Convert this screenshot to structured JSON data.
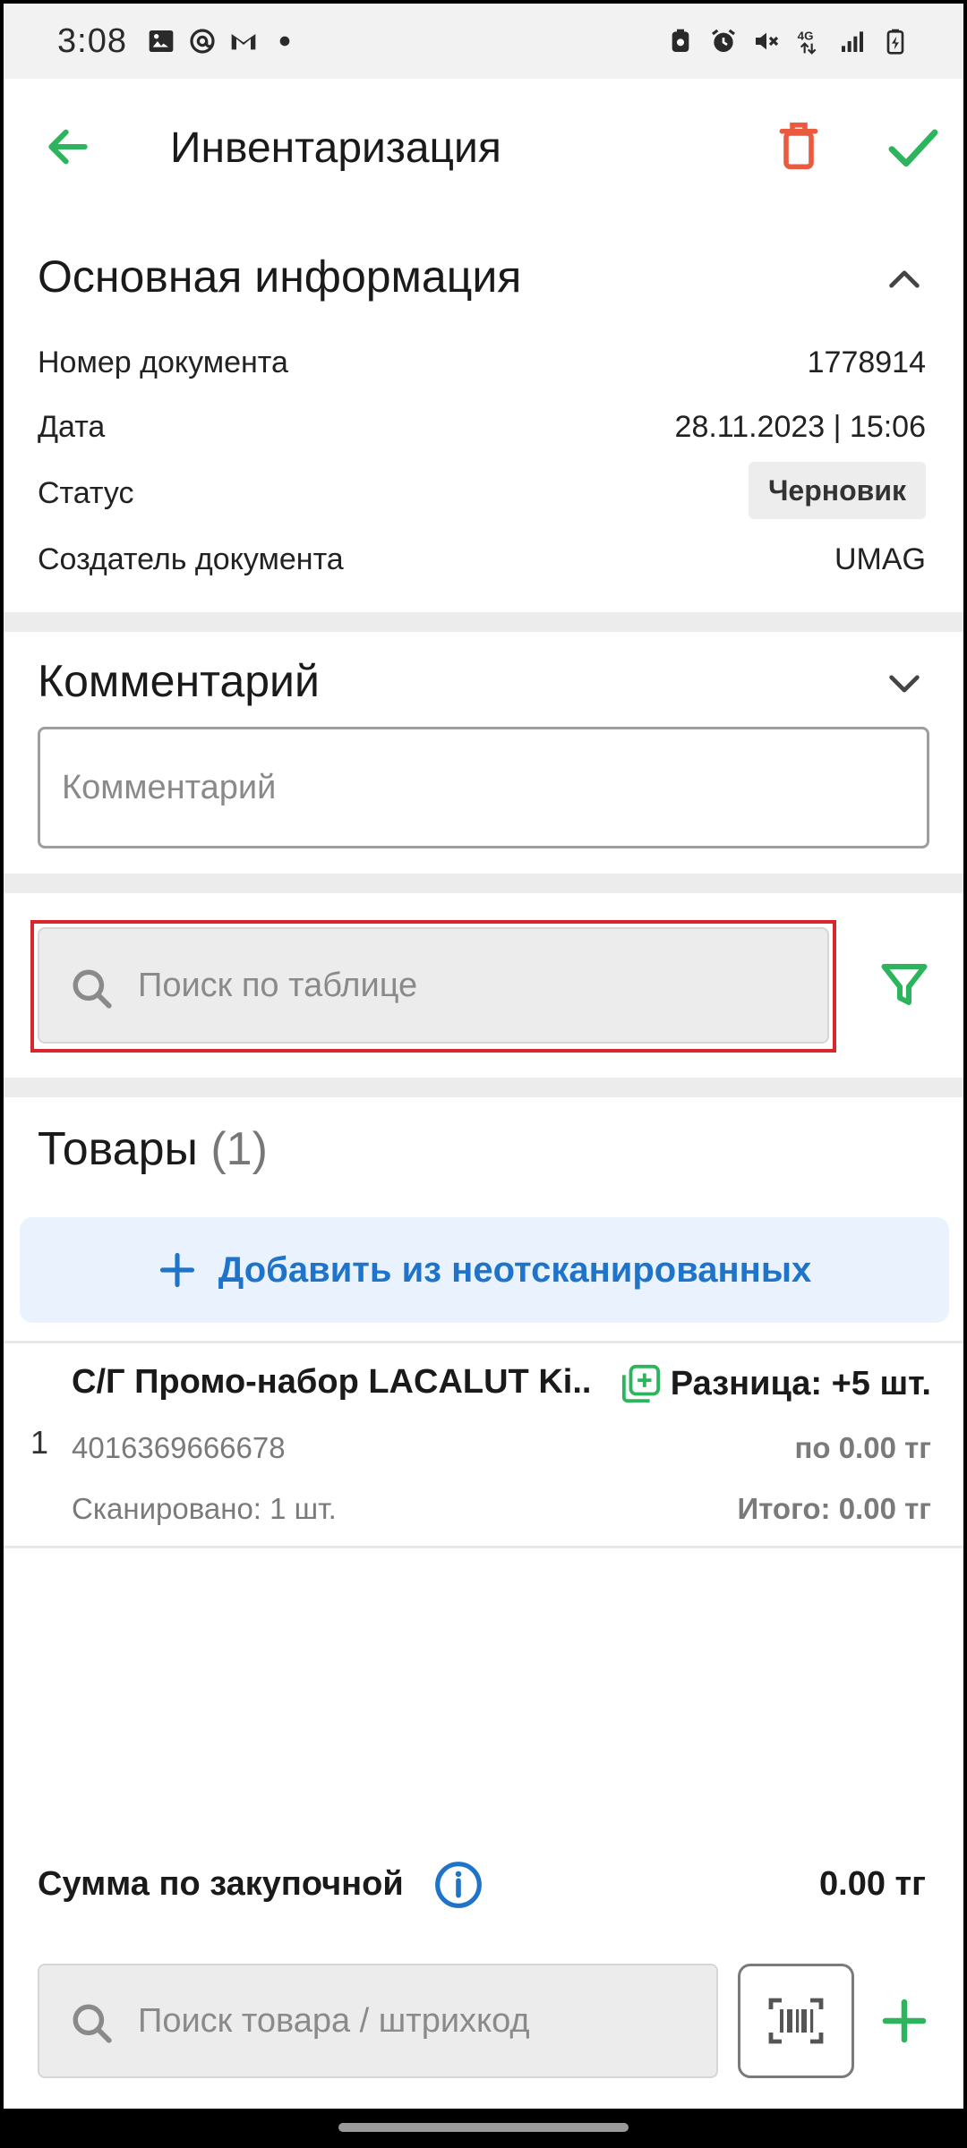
{
  "status_bar": {
    "time": "3:08",
    "left_icons": [
      "gallery-icon",
      "at-icon",
      "gmail-icon",
      "dot-icon"
    ],
    "right_icons": [
      "battery-saver-icon",
      "alarm-icon",
      "mute-icon",
      "network-4g-icon",
      "signal-icon",
      "battery-icon"
    ]
  },
  "app_bar": {
    "title": "Инвентаризация",
    "back_icon": "arrow-left-icon",
    "delete_icon": "trash-icon",
    "confirm_icon": "checkmark-icon"
  },
  "main_info": {
    "title": "Основная информация",
    "rows": [
      {
        "label": "Номер документа",
        "value": "1778914"
      },
      {
        "label": "Дата",
        "value": "28.11.2023 | 15:06"
      },
      {
        "label": "Статус",
        "value": "Черновик"
      },
      {
        "label": "Создатель документа",
        "value": "UMAG"
      }
    ]
  },
  "comment": {
    "title": "Комментарий",
    "placeholder": "Комментарий",
    "value": ""
  },
  "table_search": {
    "placeholder": "Поиск по таблице"
  },
  "goods": {
    "title": "Товары",
    "count": "(1)",
    "add_label": "Добавить из неотсканированных",
    "items": [
      {
        "index": "1",
        "name": "С/Г Промо-набор LACALUT Ki..",
        "barcode": "4016369666678",
        "scanned": "Сканировано: 1 шт.",
        "difference": "Разница: +5 шт.",
        "price": "по 0.00 тг",
        "total": "Итого: 0.00 тг"
      }
    ]
  },
  "summary": {
    "label": "Сумма по закупочной",
    "value": "0.00 тг"
  },
  "bottom_search": {
    "placeholder": "Поиск товара / штрихкод"
  },
  "colors": {
    "accent_green": "#2db55d",
    "delete_red": "#ea5a3f",
    "link_blue": "#1f74c9",
    "highlight_red": "#d9262e"
  }
}
